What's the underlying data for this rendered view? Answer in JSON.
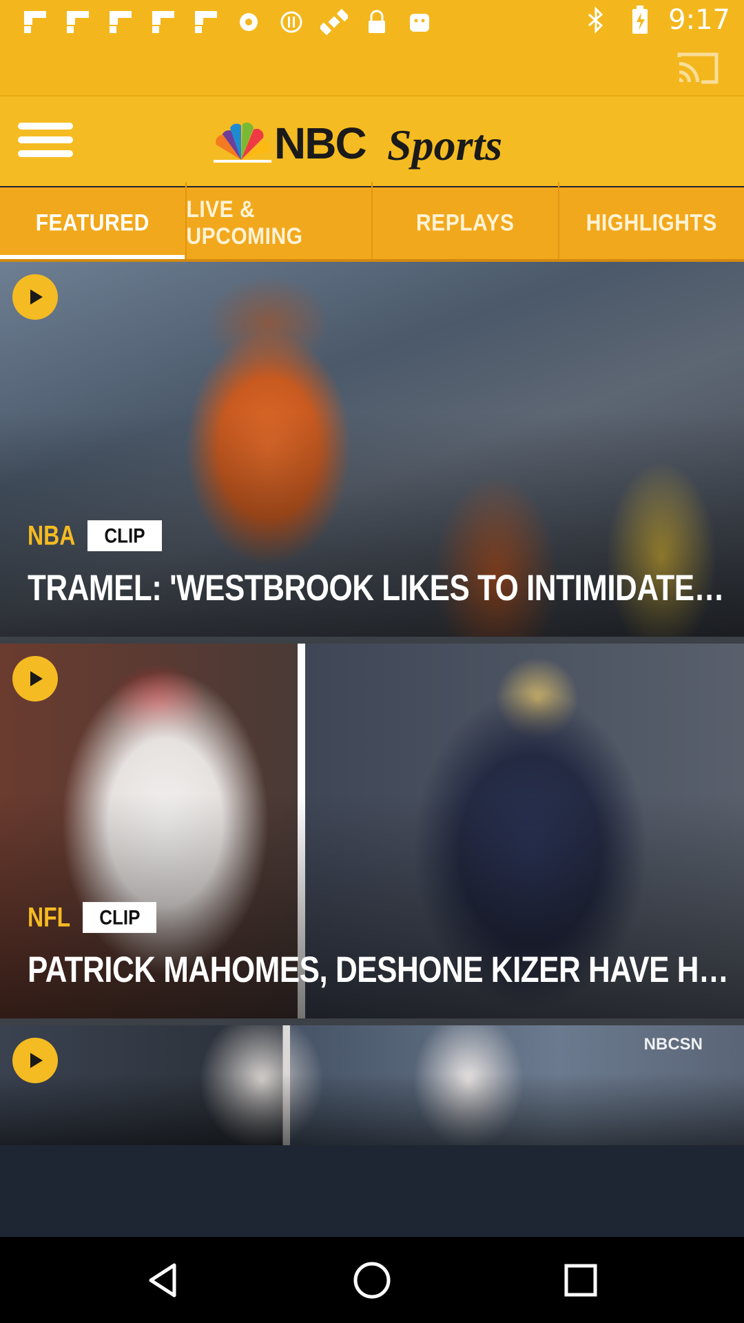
{
  "status_bar": {
    "time": "9:17",
    "left_icons": [
      "flipboard-icon",
      "flipboard-icon",
      "flipboard-icon",
      "flipboard-icon",
      "flipboard-icon",
      "record-icon",
      "info-circle-icon",
      "satellite-icon",
      "lock-icon",
      "android-icon"
    ],
    "right_icons": [
      "bluetooth-icon",
      "battery-icon"
    ]
  },
  "cast": {
    "icon": "cast-icon"
  },
  "app_bar": {
    "logo_text": "NBCSports",
    "menu_icon": "hamburger-menu-icon"
  },
  "tabs": [
    {
      "label": "FEATURED",
      "active": true
    },
    {
      "label": "LIVE & UPCOMING",
      "active": false
    },
    {
      "label": "REPLAYS",
      "active": false
    },
    {
      "label": "HIGHLIGHTS",
      "active": false
    }
  ],
  "cards": [
    {
      "sport": "NBA",
      "badge": "CLIP",
      "headline": "TRAMEL: 'WESTBROOK LIKES TO INTIMIDATE PEOPLE'"
    },
    {
      "sport": "NFL",
      "badge": "CLIP",
      "headline": "PATRICK MAHOMES, DESHONE KIZER HAVE HUGE POTEN..."
    },
    {
      "sport": "",
      "badge": "",
      "headline": "",
      "watermark": "NBCSN"
    }
  ],
  "nav": {
    "back": "back-icon",
    "home": "home-icon",
    "recents": "recents-icon"
  },
  "colors": {
    "brand_yellow": "#f5bb22",
    "tab_orange": "#f2a81c",
    "background": "#1f2633"
  }
}
